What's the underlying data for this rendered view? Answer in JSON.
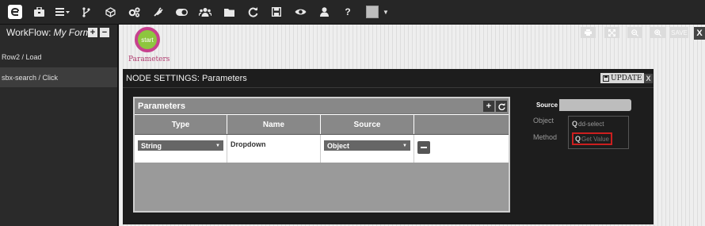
{
  "toolbar": {
    "icons": [
      "logo-icon",
      "briefcase-icon",
      "list-icon",
      "branch-icon",
      "cube-icon",
      "cogs-icon",
      "plug-icon",
      "toggle-icon",
      "users-icon",
      "folder-icon",
      "refresh-icon",
      "floppy-icon",
      "eye-icon",
      "user-icon",
      "help-icon"
    ],
    "help_label": "?"
  },
  "sidebar": {
    "workflow_label": "WorkFlow:",
    "workflow_name": "My Form",
    "add_label": "+",
    "remove_label": "−",
    "items": [
      {
        "label": "Row2 / Load"
      },
      {
        "label": "sbx-search / Click"
      }
    ]
  },
  "canvas": {
    "start_node_label": "start",
    "start_node_caption": "Parameters",
    "controls": {
      "save_label": "SAVE",
      "close_label": "X"
    }
  },
  "node_settings": {
    "title": "NODE SETTINGS: Parameters",
    "update_label": "UPDATE",
    "close_label": "X",
    "parameters": {
      "header": "Parameters",
      "add_label": "+",
      "columns": [
        "Type",
        "Name",
        "Source"
      ],
      "rows": [
        {
          "type": "String",
          "name": "Dropdown",
          "source": "Object"
        }
      ]
    },
    "source": {
      "tab_label": "Source",
      "object_label": "Object",
      "method_label": "Method",
      "options": [
        {
          "label": "dd-select",
          "selected": false
        },
        {
          "label": "Get Value",
          "selected": true
        }
      ]
    }
  },
  "colors": {
    "start_fill": "#8dc63f",
    "start_ring": "#c7418e",
    "highlight": "#cc1f1f"
  }
}
